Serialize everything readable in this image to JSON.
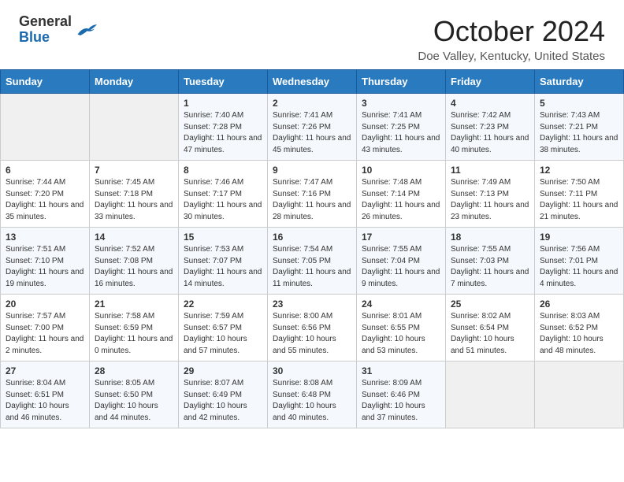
{
  "header": {
    "logo_general": "General",
    "logo_blue": "Blue",
    "month_title": "October 2024",
    "location": "Doe Valley, Kentucky, United States"
  },
  "weekdays": [
    "Sunday",
    "Monday",
    "Tuesday",
    "Wednesday",
    "Thursday",
    "Friday",
    "Saturday"
  ],
  "weeks": [
    [
      {
        "day": "",
        "sunrise": "",
        "sunset": "",
        "daylight": "",
        "empty": true
      },
      {
        "day": "",
        "sunrise": "",
        "sunset": "",
        "daylight": "",
        "empty": true
      },
      {
        "day": "1",
        "sunrise": "Sunrise: 7:40 AM",
        "sunset": "Sunset: 7:28 PM",
        "daylight": "Daylight: 11 hours and 47 minutes.",
        "empty": false
      },
      {
        "day": "2",
        "sunrise": "Sunrise: 7:41 AM",
        "sunset": "Sunset: 7:26 PM",
        "daylight": "Daylight: 11 hours and 45 minutes.",
        "empty": false
      },
      {
        "day": "3",
        "sunrise": "Sunrise: 7:41 AM",
        "sunset": "Sunset: 7:25 PM",
        "daylight": "Daylight: 11 hours and 43 minutes.",
        "empty": false
      },
      {
        "day": "4",
        "sunrise": "Sunrise: 7:42 AM",
        "sunset": "Sunset: 7:23 PM",
        "daylight": "Daylight: 11 hours and 40 minutes.",
        "empty": false
      },
      {
        "day": "5",
        "sunrise": "Sunrise: 7:43 AM",
        "sunset": "Sunset: 7:21 PM",
        "daylight": "Daylight: 11 hours and 38 minutes.",
        "empty": false
      }
    ],
    [
      {
        "day": "6",
        "sunrise": "Sunrise: 7:44 AM",
        "sunset": "Sunset: 7:20 PM",
        "daylight": "Daylight: 11 hours and 35 minutes.",
        "empty": false
      },
      {
        "day": "7",
        "sunrise": "Sunrise: 7:45 AM",
        "sunset": "Sunset: 7:18 PM",
        "daylight": "Daylight: 11 hours and 33 minutes.",
        "empty": false
      },
      {
        "day": "8",
        "sunrise": "Sunrise: 7:46 AM",
        "sunset": "Sunset: 7:17 PM",
        "daylight": "Daylight: 11 hours and 30 minutes.",
        "empty": false
      },
      {
        "day": "9",
        "sunrise": "Sunrise: 7:47 AM",
        "sunset": "Sunset: 7:16 PM",
        "daylight": "Daylight: 11 hours and 28 minutes.",
        "empty": false
      },
      {
        "day": "10",
        "sunrise": "Sunrise: 7:48 AM",
        "sunset": "Sunset: 7:14 PM",
        "daylight": "Daylight: 11 hours and 26 minutes.",
        "empty": false
      },
      {
        "day": "11",
        "sunrise": "Sunrise: 7:49 AM",
        "sunset": "Sunset: 7:13 PM",
        "daylight": "Daylight: 11 hours and 23 minutes.",
        "empty": false
      },
      {
        "day": "12",
        "sunrise": "Sunrise: 7:50 AM",
        "sunset": "Sunset: 7:11 PM",
        "daylight": "Daylight: 11 hours and 21 minutes.",
        "empty": false
      }
    ],
    [
      {
        "day": "13",
        "sunrise": "Sunrise: 7:51 AM",
        "sunset": "Sunset: 7:10 PM",
        "daylight": "Daylight: 11 hours and 19 minutes.",
        "empty": false
      },
      {
        "day": "14",
        "sunrise": "Sunrise: 7:52 AM",
        "sunset": "Sunset: 7:08 PM",
        "daylight": "Daylight: 11 hours and 16 minutes.",
        "empty": false
      },
      {
        "day": "15",
        "sunrise": "Sunrise: 7:53 AM",
        "sunset": "Sunset: 7:07 PM",
        "daylight": "Daylight: 11 hours and 14 minutes.",
        "empty": false
      },
      {
        "day": "16",
        "sunrise": "Sunrise: 7:54 AM",
        "sunset": "Sunset: 7:05 PM",
        "daylight": "Daylight: 11 hours and 11 minutes.",
        "empty": false
      },
      {
        "day": "17",
        "sunrise": "Sunrise: 7:55 AM",
        "sunset": "Sunset: 7:04 PM",
        "daylight": "Daylight: 11 hours and 9 minutes.",
        "empty": false
      },
      {
        "day": "18",
        "sunrise": "Sunrise: 7:55 AM",
        "sunset": "Sunset: 7:03 PM",
        "daylight": "Daylight: 11 hours and 7 minutes.",
        "empty": false
      },
      {
        "day": "19",
        "sunrise": "Sunrise: 7:56 AM",
        "sunset": "Sunset: 7:01 PM",
        "daylight": "Daylight: 11 hours and 4 minutes.",
        "empty": false
      }
    ],
    [
      {
        "day": "20",
        "sunrise": "Sunrise: 7:57 AM",
        "sunset": "Sunset: 7:00 PM",
        "daylight": "Daylight: 11 hours and 2 minutes.",
        "empty": false
      },
      {
        "day": "21",
        "sunrise": "Sunrise: 7:58 AM",
        "sunset": "Sunset: 6:59 PM",
        "daylight": "Daylight: 11 hours and 0 minutes.",
        "empty": false
      },
      {
        "day": "22",
        "sunrise": "Sunrise: 7:59 AM",
        "sunset": "Sunset: 6:57 PM",
        "daylight": "Daylight: 10 hours and 57 minutes.",
        "empty": false
      },
      {
        "day": "23",
        "sunrise": "Sunrise: 8:00 AM",
        "sunset": "Sunset: 6:56 PM",
        "daylight": "Daylight: 10 hours and 55 minutes.",
        "empty": false
      },
      {
        "day": "24",
        "sunrise": "Sunrise: 8:01 AM",
        "sunset": "Sunset: 6:55 PM",
        "daylight": "Daylight: 10 hours and 53 minutes.",
        "empty": false
      },
      {
        "day": "25",
        "sunrise": "Sunrise: 8:02 AM",
        "sunset": "Sunset: 6:54 PM",
        "daylight": "Daylight: 10 hours and 51 minutes.",
        "empty": false
      },
      {
        "day": "26",
        "sunrise": "Sunrise: 8:03 AM",
        "sunset": "Sunset: 6:52 PM",
        "daylight": "Daylight: 10 hours and 48 minutes.",
        "empty": false
      }
    ],
    [
      {
        "day": "27",
        "sunrise": "Sunrise: 8:04 AM",
        "sunset": "Sunset: 6:51 PM",
        "daylight": "Daylight: 10 hours and 46 minutes.",
        "empty": false
      },
      {
        "day": "28",
        "sunrise": "Sunrise: 8:05 AM",
        "sunset": "Sunset: 6:50 PM",
        "daylight": "Daylight: 10 hours and 44 minutes.",
        "empty": false
      },
      {
        "day": "29",
        "sunrise": "Sunrise: 8:07 AM",
        "sunset": "Sunset: 6:49 PM",
        "daylight": "Daylight: 10 hours and 42 minutes.",
        "empty": false
      },
      {
        "day": "30",
        "sunrise": "Sunrise: 8:08 AM",
        "sunset": "Sunset: 6:48 PM",
        "daylight": "Daylight: 10 hours and 40 minutes.",
        "empty": false
      },
      {
        "day": "31",
        "sunrise": "Sunrise: 8:09 AM",
        "sunset": "Sunset: 6:46 PM",
        "daylight": "Daylight: 10 hours and 37 minutes.",
        "empty": false
      },
      {
        "day": "",
        "sunrise": "",
        "sunset": "",
        "daylight": "",
        "empty": true
      },
      {
        "day": "",
        "sunrise": "",
        "sunset": "",
        "daylight": "",
        "empty": true
      }
    ]
  ]
}
